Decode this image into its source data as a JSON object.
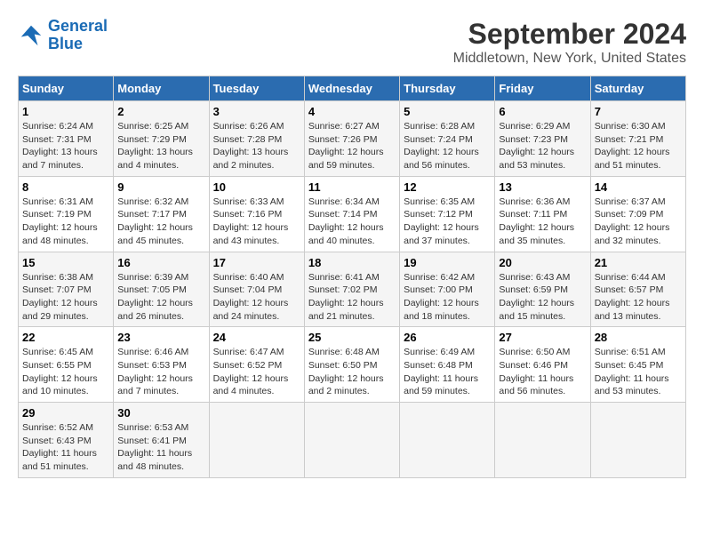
{
  "logo": {
    "line1": "General",
    "line2": "Blue"
  },
  "title": "September 2024",
  "subtitle": "Middletown, New York, United States",
  "headers": [
    "Sunday",
    "Monday",
    "Tuesday",
    "Wednesday",
    "Thursday",
    "Friday",
    "Saturday"
  ],
  "weeks": [
    [
      {
        "day": "1",
        "sunrise": "Sunrise: 6:24 AM",
        "sunset": "Sunset: 7:31 PM",
        "daylight": "Daylight: 13 hours and 7 minutes."
      },
      {
        "day": "2",
        "sunrise": "Sunrise: 6:25 AM",
        "sunset": "Sunset: 7:29 PM",
        "daylight": "Daylight: 13 hours and 4 minutes."
      },
      {
        "day": "3",
        "sunrise": "Sunrise: 6:26 AM",
        "sunset": "Sunset: 7:28 PM",
        "daylight": "Daylight: 13 hours and 2 minutes."
      },
      {
        "day": "4",
        "sunrise": "Sunrise: 6:27 AM",
        "sunset": "Sunset: 7:26 PM",
        "daylight": "Daylight: 12 hours and 59 minutes."
      },
      {
        "day": "5",
        "sunrise": "Sunrise: 6:28 AM",
        "sunset": "Sunset: 7:24 PM",
        "daylight": "Daylight: 12 hours and 56 minutes."
      },
      {
        "day": "6",
        "sunrise": "Sunrise: 6:29 AM",
        "sunset": "Sunset: 7:23 PM",
        "daylight": "Daylight: 12 hours and 53 minutes."
      },
      {
        "day": "7",
        "sunrise": "Sunrise: 6:30 AM",
        "sunset": "Sunset: 7:21 PM",
        "daylight": "Daylight: 12 hours and 51 minutes."
      }
    ],
    [
      {
        "day": "8",
        "sunrise": "Sunrise: 6:31 AM",
        "sunset": "Sunset: 7:19 PM",
        "daylight": "Daylight: 12 hours and 48 minutes."
      },
      {
        "day": "9",
        "sunrise": "Sunrise: 6:32 AM",
        "sunset": "Sunset: 7:17 PM",
        "daylight": "Daylight: 12 hours and 45 minutes."
      },
      {
        "day": "10",
        "sunrise": "Sunrise: 6:33 AM",
        "sunset": "Sunset: 7:16 PM",
        "daylight": "Daylight: 12 hours and 43 minutes."
      },
      {
        "day": "11",
        "sunrise": "Sunrise: 6:34 AM",
        "sunset": "Sunset: 7:14 PM",
        "daylight": "Daylight: 12 hours and 40 minutes."
      },
      {
        "day": "12",
        "sunrise": "Sunrise: 6:35 AM",
        "sunset": "Sunset: 7:12 PM",
        "daylight": "Daylight: 12 hours and 37 minutes."
      },
      {
        "day": "13",
        "sunrise": "Sunrise: 6:36 AM",
        "sunset": "Sunset: 7:11 PM",
        "daylight": "Daylight: 12 hours and 35 minutes."
      },
      {
        "day": "14",
        "sunrise": "Sunrise: 6:37 AM",
        "sunset": "Sunset: 7:09 PM",
        "daylight": "Daylight: 12 hours and 32 minutes."
      }
    ],
    [
      {
        "day": "15",
        "sunrise": "Sunrise: 6:38 AM",
        "sunset": "Sunset: 7:07 PM",
        "daylight": "Daylight: 12 hours and 29 minutes."
      },
      {
        "day": "16",
        "sunrise": "Sunrise: 6:39 AM",
        "sunset": "Sunset: 7:05 PM",
        "daylight": "Daylight: 12 hours and 26 minutes."
      },
      {
        "day": "17",
        "sunrise": "Sunrise: 6:40 AM",
        "sunset": "Sunset: 7:04 PM",
        "daylight": "Daylight: 12 hours and 24 minutes."
      },
      {
        "day": "18",
        "sunrise": "Sunrise: 6:41 AM",
        "sunset": "Sunset: 7:02 PM",
        "daylight": "Daylight: 12 hours and 21 minutes."
      },
      {
        "day": "19",
        "sunrise": "Sunrise: 6:42 AM",
        "sunset": "Sunset: 7:00 PM",
        "daylight": "Daylight: 12 hours and 18 minutes."
      },
      {
        "day": "20",
        "sunrise": "Sunrise: 6:43 AM",
        "sunset": "Sunset: 6:59 PM",
        "daylight": "Daylight: 12 hours and 15 minutes."
      },
      {
        "day": "21",
        "sunrise": "Sunrise: 6:44 AM",
        "sunset": "Sunset: 6:57 PM",
        "daylight": "Daylight: 12 hours and 13 minutes."
      }
    ],
    [
      {
        "day": "22",
        "sunrise": "Sunrise: 6:45 AM",
        "sunset": "Sunset: 6:55 PM",
        "daylight": "Daylight: 12 hours and 10 minutes."
      },
      {
        "day": "23",
        "sunrise": "Sunrise: 6:46 AM",
        "sunset": "Sunset: 6:53 PM",
        "daylight": "Daylight: 12 hours and 7 minutes."
      },
      {
        "day": "24",
        "sunrise": "Sunrise: 6:47 AM",
        "sunset": "Sunset: 6:52 PM",
        "daylight": "Daylight: 12 hours and 4 minutes."
      },
      {
        "day": "25",
        "sunrise": "Sunrise: 6:48 AM",
        "sunset": "Sunset: 6:50 PM",
        "daylight": "Daylight: 12 hours and 2 minutes."
      },
      {
        "day": "26",
        "sunrise": "Sunrise: 6:49 AM",
        "sunset": "Sunset: 6:48 PM",
        "daylight": "Daylight: 11 hours and 59 minutes."
      },
      {
        "day": "27",
        "sunrise": "Sunrise: 6:50 AM",
        "sunset": "Sunset: 6:46 PM",
        "daylight": "Daylight: 11 hours and 56 minutes."
      },
      {
        "day": "28",
        "sunrise": "Sunrise: 6:51 AM",
        "sunset": "Sunset: 6:45 PM",
        "daylight": "Daylight: 11 hours and 53 minutes."
      }
    ],
    [
      {
        "day": "29",
        "sunrise": "Sunrise: 6:52 AM",
        "sunset": "Sunset: 6:43 PM",
        "daylight": "Daylight: 11 hours and 51 minutes."
      },
      {
        "day": "30",
        "sunrise": "Sunrise: 6:53 AM",
        "sunset": "Sunset: 6:41 PM",
        "daylight": "Daylight: 11 hours and 48 minutes."
      },
      null,
      null,
      null,
      null,
      null
    ]
  ]
}
